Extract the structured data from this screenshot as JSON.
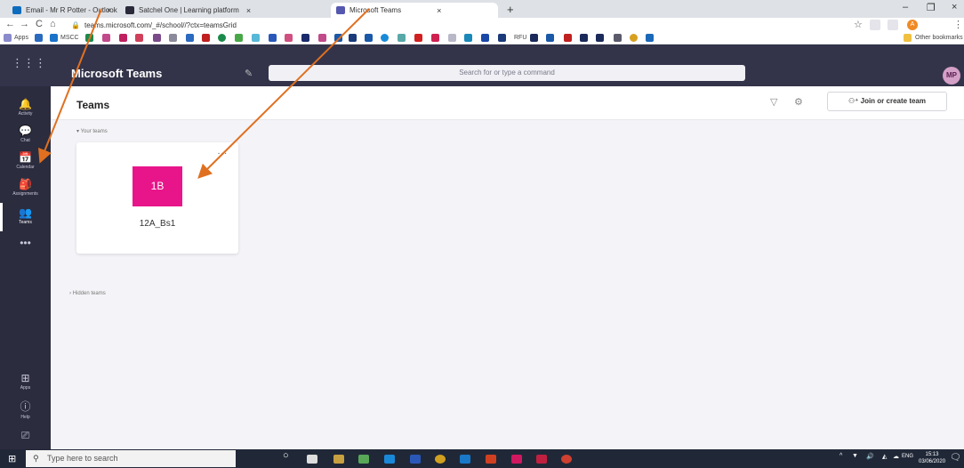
{
  "browser": {
    "tabs": [
      {
        "title": "Email - Mr R Potter - Outlook",
        "favicon_color": "#0f6cbd"
      },
      {
        "title": "Satchel One | Learning platform",
        "favicon_color": "#2a2a3a"
      },
      {
        "title": "Microsoft Teams",
        "favicon_color": "#5558af",
        "active": true
      }
    ],
    "tab_close_glyph": "×",
    "new_tab": "+",
    "url": "teams.microsoft.com/_#/school//?ctx=teamsGrid",
    "bookmarks": {
      "apps_label": "Apps",
      "mscc_label": "MSCC",
      "rfu_label": "RFU",
      "other_label": "Other bookmarks"
    },
    "avatar_initial": "A"
  },
  "teams": {
    "app_title": "Microsoft Teams",
    "search_placeholder": "Search for or type a command",
    "user_initials": "MP",
    "rail": [
      {
        "label": "Activity",
        "icon": "bell-icon",
        "glyph": "🔔"
      },
      {
        "label": "Chat",
        "icon": "chat-icon",
        "glyph": "💬"
      },
      {
        "label": "Calendar",
        "icon": "calendar-icon",
        "glyph": "📅"
      },
      {
        "label": "Assignments",
        "icon": "assignments-icon",
        "glyph": "🎒"
      },
      {
        "label": "Teams",
        "icon": "teams-icon",
        "glyph": "👥",
        "active": true
      },
      {
        "label": "",
        "icon": "more-icon",
        "glyph": "•••"
      }
    ],
    "rail_bottom": [
      {
        "label": "Apps",
        "icon": "apps-icon",
        "glyph": "⊞"
      },
      {
        "label": "Help",
        "icon": "help-icon",
        "glyph": "?"
      },
      {
        "label": "",
        "icon": "device-icon",
        "glyph": "⎚"
      }
    ],
    "header_title": "Teams",
    "join_button": "Join or create team",
    "your_teams_label": "Your teams",
    "hidden_teams_label": "Hidden teams",
    "team_card": {
      "tile_text": "1B",
      "tile_color": "#e8158a",
      "name": "12A_Bs1",
      "more": "..."
    }
  },
  "taskbar": {
    "search_placeholder": "Type here to search",
    "lang": "ENG",
    "time": "15:13",
    "date": "03/06/2020"
  },
  "annotation": {
    "arrow_color": "#e07020"
  }
}
